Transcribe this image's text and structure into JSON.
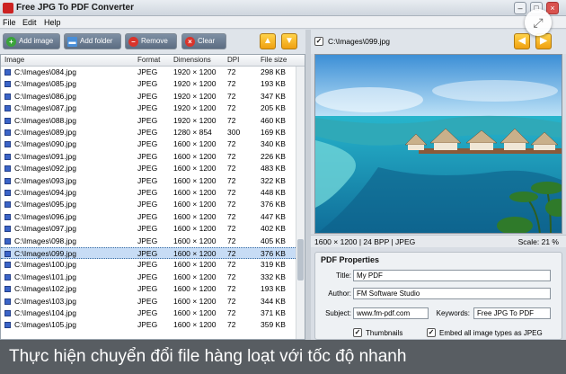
{
  "window": {
    "title": "Free JPG To PDF Converter"
  },
  "menu": [
    "File",
    "Edit",
    "Help"
  ],
  "toolbar": {
    "add_image": "Add image",
    "add_folder": "Add folder",
    "remove": "Remove",
    "clear": "Clear"
  },
  "columns": [
    "Image",
    "Format",
    "Dimensions",
    "DPI",
    "File size"
  ],
  "files": [
    {
      "name": "C:\\Images\\084.jpg",
      "format": "JPEG",
      "dim": "1920 × 1200",
      "dpi": "72",
      "size": "298 KB"
    },
    {
      "name": "C:\\Images\\085.jpg",
      "format": "JPEG",
      "dim": "1920 × 1200",
      "dpi": "72",
      "size": "193 KB"
    },
    {
      "name": "C:\\Images\\086.jpg",
      "format": "JPEG",
      "dim": "1920 × 1200",
      "dpi": "72",
      "size": "347 KB"
    },
    {
      "name": "C:\\Images\\087.jpg",
      "format": "JPEG",
      "dim": "1920 × 1200",
      "dpi": "72",
      "size": "205 KB"
    },
    {
      "name": "C:\\Images\\088.jpg",
      "format": "JPEG",
      "dim": "1920 × 1200",
      "dpi": "72",
      "size": "460 KB"
    },
    {
      "name": "C:\\Images\\089.jpg",
      "format": "JPEG",
      "dim": "1280 × 854",
      "dpi": "300",
      "size": "169 KB"
    },
    {
      "name": "C:\\Images\\090.jpg",
      "format": "JPEG",
      "dim": "1600 × 1200",
      "dpi": "72",
      "size": "340 KB"
    },
    {
      "name": "C:\\Images\\091.jpg",
      "format": "JPEG",
      "dim": "1600 × 1200",
      "dpi": "72",
      "size": "226 KB"
    },
    {
      "name": "C:\\Images\\092.jpg",
      "format": "JPEG",
      "dim": "1600 × 1200",
      "dpi": "72",
      "size": "483 KB"
    },
    {
      "name": "C:\\Images\\093.jpg",
      "format": "JPEG",
      "dim": "1600 × 1200",
      "dpi": "72",
      "size": "322 KB"
    },
    {
      "name": "C:\\Images\\094.jpg",
      "format": "JPEG",
      "dim": "1600 × 1200",
      "dpi": "72",
      "size": "448 KB"
    },
    {
      "name": "C:\\Images\\095.jpg",
      "format": "JPEG",
      "dim": "1600 × 1200",
      "dpi": "72",
      "size": "376 KB"
    },
    {
      "name": "C:\\Images\\096.jpg",
      "format": "JPEG",
      "dim": "1600 × 1200",
      "dpi": "72",
      "size": "447 KB"
    },
    {
      "name": "C:\\Images\\097.jpg",
      "format": "JPEG",
      "dim": "1600 × 1200",
      "dpi": "72",
      "size": "402 KB"
    },
    {
      "name": "C:\\Images\\098.jpg",
      "format": "JPEG",
      "dim": "1600 × 1200",
      "dpi": "72",
      "size": "405 KB"
    },
    {
      "name": "C:\\Images\\099.jpg",
      "format": "JPEG",
      "dim": "1600 × 1200",
      "dpi": "72",
      "size": "376 KB",
      "selected": true
    },
    {
      "name": "C:\\Images\\100.jpg",
      "format": "JPEG",
      "dim": "1600 × 1200",
      "dpi": "72",
      "size": "319 KB"
    },
    {
      "name": "C:\\Images\\101.jpg",
      "format": "JPEG",
      "dim": "1600 × 1200",
      "dpi": "72",
      "size": "332 KB"
    },
    {
      "name": "C:\\Images\\102.jpg",
      "format": "JPEG",
      "dim": "1600 × 1200",
      "dpi": "72",
      "size": "193 KB"
    },
    {
      "name": "C:\\Images\\103.jpg",
      "format": "JPEG",
      "dim": "1600 × 1200",
      "dpi": "72",
      "size": "344 KB"
    },
    {
      "name": "C:\\Images\\104.jpg",
      "format": "JPEG",
      "dim": "1600 × 1200",
      "dpi": "72",
      "size": "371 KB"
    },
    {
      "name": "C:\\Images\\105.jpg",
      "format": "JPEG",
      "dim": "1600 × 1200",
      "dpi": "72",
      "size": "359 KB"
    }
  ],
  "preview": {
    "path": "C:\\Images\\099.jpg",
    "info": "1600 × 1200  |  24 BPP  |  JPEG",
    "scale": "Scale: 21 %"
  },
  "pdf": {
    "section_title": "PDF Properties",
    "title_label": "Title:",
    "title_value": "My PDF",
    "author_label": "Author:",
    "author_value": "FM Software Studio",
    "subject_label": "Subject:",
    "subject_value": "www.fm-pdf.com",
    "keywords_label": "Keywords:",
    "keywords_value": "Free JPG To PDF",
    "thumbnails_label": "Thumbnails",
    "embed_label": "Embed all image types as JPEG"
  },
  "caption": "Thực hiện chuyển đổi file hàng loạt với tốc độ nhanh",
  "icons": {
    "add": "plus-icon",
    "folder": "folder-icon",
    "remove": "minus-icon",
    "clear": "x-icon",
    "up": "arrow-up-icon",
    "down": "arrow-down-icon",
    "prev": "arrow-left-icon",
    "next": "arrow-right-icon",
    "expand": "expand-icon"
  },
  "colors": {
    "selection": "#c7dcf5",
    "accent_orange": "#f0a010",
    "add_green": "#3aa33a",
    "remove_red": "#d9342b"
  }
}
